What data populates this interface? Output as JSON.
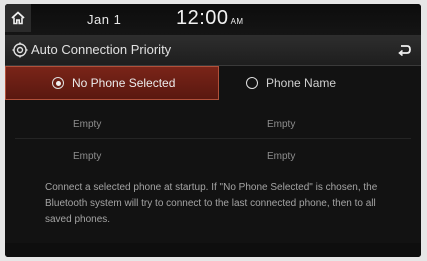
{
  "status_bar": {
    "date": "Jan   1",
    "time": "12:00",
    "ampm": "AM"
  },
  "header": {
    "title": "Auto Connection Priority"
  },
  "tabs": [
    {
      "label": "No Phone Selected",
      "selected": true
    },
    {
      "label": "Phone Name",
      "selected": false
    }
  ],
  "rows": [
    {
      "left": "Empty",
      "right": "Empty"
    },
    {
      "left": "Empty",
      "right": "Empty"
    }
  ],
  "description": "Connect a selected phone at startup. If \"No Phone Selected\" is chosen, the Bluetooth system will try to connect to the last connected phone, then to all saved phones.",
  "colors": {
    "selected_tab": "#6e2015",
    "background": "#121212",
    "text_dim": "#8e8e8e"
  }
}
